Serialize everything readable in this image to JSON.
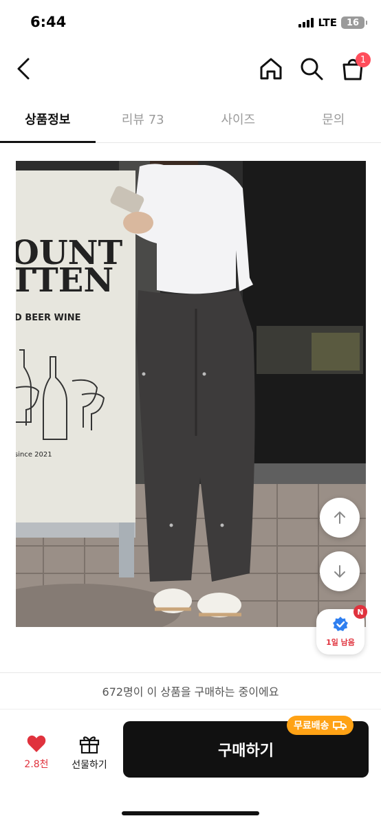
{
  "status_bar": {
    "time": "6:44",
    "network": "LTE",
    "battery": "16"
  },
  "header": {
    "cart_count": "1"
  },
  "tabs": [
    {
      "label": "상품정보",
      "active": true
    },
    {
      "label": "리뷰 73",
      "active": false
    },
    {
      "label": "사이즈",
      "active": false
    },
    {
      "label": "문의",
      "active": false
    }
  ],
  "photo": {
    "sign_line1": "OUNT",
    "sign_line2": "TTEN",
    "sign_subtitle": "D BEER WINE",
    "sign_since": "since 2021"
  },
  "floating": {
    "deadline_label": "1일 남음",
    "new_badge": "N"
  },
  "purchase_notice": "672명이 이 상품을 구매하는 중이에요",
  "bottom_bar": {
    "like_count": "2.8천",
    "gift_label": "선물하기",
    "buy_label": "구매하기",
    "shipping_badge": "무료배송"
  },
  "colors": {
    "accent_red": "#e0323d",
    "shipping_orange": "#ffa215",
    "buy_button": "#111111"
  },
  "icons": [
    "back-arrow-icon",
    "home-icon",
    "search-icon",
    "cart-icon",
    "arrow-up-icon",
    "arrow-down-icon",
    "verified-check-icon",
    "heart-icon",
    "gift-icon",
    "truck-icon"
  ]
}
